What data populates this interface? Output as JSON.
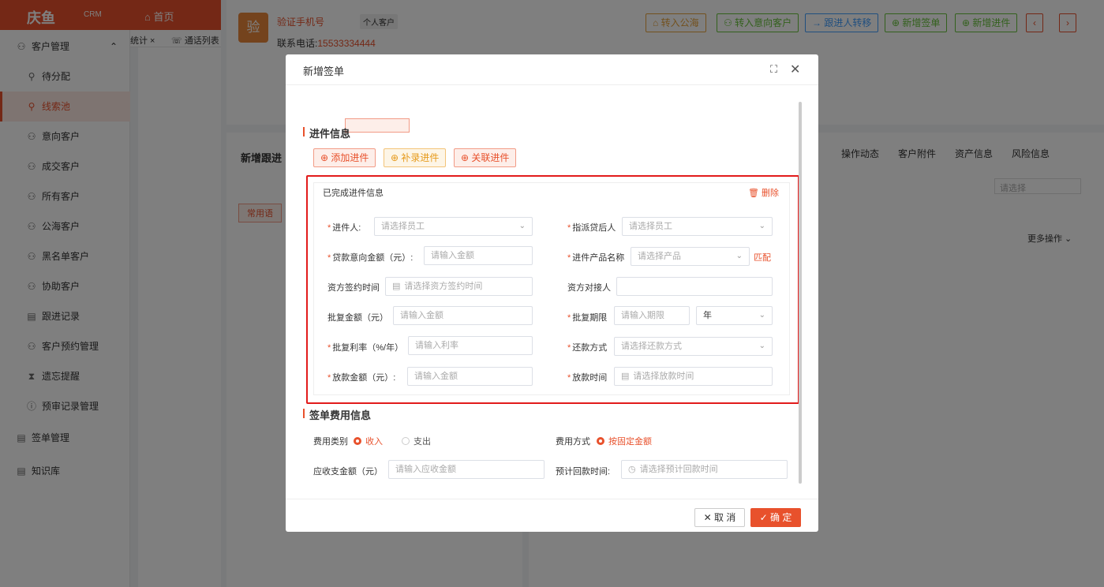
{
  "app": {
    "logo": "庆鱼",
    "logo_sub": "CRM",
    "nav_home": "首页"
  },
  "sidebar": {
    "group": "客户管理",
    "items": [
      {
        "label": "待分配"
      },
      {
        "label": "线索池"
      },
      {
        "label": "意向客户"
      },
      {
        "label": "成交客户"
      },
      {
        "label": "所有客户"
      },
      {
        "label": "公海客户"
      },
      {
        "label": "黑名单客户"
      },
      {
        "label": "协助客户"
      },
      {
        "label": "跟进记录"
      },
      {
        "label": "客户预约管理"
      },
      {
        "label": "遗忘提醒"
      },
      {
        "label": "预审记录管理"
      }
    ],
    "sections": [
      {
        "label": "签单管理"
      },
      {
        "label": "知识库"
      }
    ]
  },
  "tabs": {
    "t1": "统计",
    "t2": "通话列表"
  },
  "customer": {
    "name": "验证手机号",
    "avatar": "验",
    "tag": "个人客户",
    "phone_label": "联系电话:",
    "phone": "15533334444"
  },
  "header_buttons": {
    "to_public": "转入公海",
    "to_intent": "转入意向客户",
    "transfer": "跟进人转移",
    "new_sign": "新增签单",
    "new_entry": "新增进件"
  },
  "right_tabs": [
    "操作动态",
    "客户附件",
    "资产信息",
    "风险信息"
  ],
  "left_card": {
    "title": "新增跟进",
    "common": "常用语",
    "select_placeholder": "请选择",
    "more_ops": "更多操作"
  },
  "modal": {
    "title": "新增签单",
    "section_entry": "进件信息",
    "btn_add": "添加进件",
    "btn_supp": "补录进件",
    "btn_link": "关联进件",
    "inner_title": "已完成进件信息",
    "delete": "删除",
    "fields": {
      "applicant_label": "进件人:",
      "applicant_ph": "请选择员工",
      "assign_label": "指派贷后人",
      "assign_ph": "请选择员工",
      "loan_amount_label": "贷款意向金额（元）:",
      "loan_amount_ph": "请输入金额",
      "product_label": "进件产品名称",
      "product_ph": "请选择产品",
      "match": "匹配",
      "sign_time_label": "资方签约时间",
      "sign_time_ph": "请选择资方签约时间",
      "contact_label": "资方对接人",
      "approve_amount_label": "批复金额（元）",
      "approve_amount_ph": "请输入金额",
      "approve_term_label": "批复期限",
      "approve_term_ph": "请输入期限",
      "term_unit": "年",
      "rate_label": "批复利率（%/年）",
      "rate_ph": "请输入利率",
      "repay_label": "还款方式",
      "repay_ph": "请选择还款方式",
      "disburse_amount_label": "放款金额（元）:",
      "disburse_amount_ph": "请输入金额",
      "disburse_time_label": "放款时间",
      "disburse_time_ph": "请选择放款时间"
    },
    "section_fee": "签单费用信息",
    "fee": {
      "type_label": "费用类别",
      "income": "收入",
      "expense": "支出",
      "method_label": "费用方式",
      "fixed": "按固定金额",
      "amount_label": "应收支金额（元）",
      "amount_ph": "请输入应收金额",
      "return_label": "预计回款时间:",
      "return_ph": "请选择预计回款时间"
    },
    "cancel": "取 消",
    "ok": "确 定"
  }
}
